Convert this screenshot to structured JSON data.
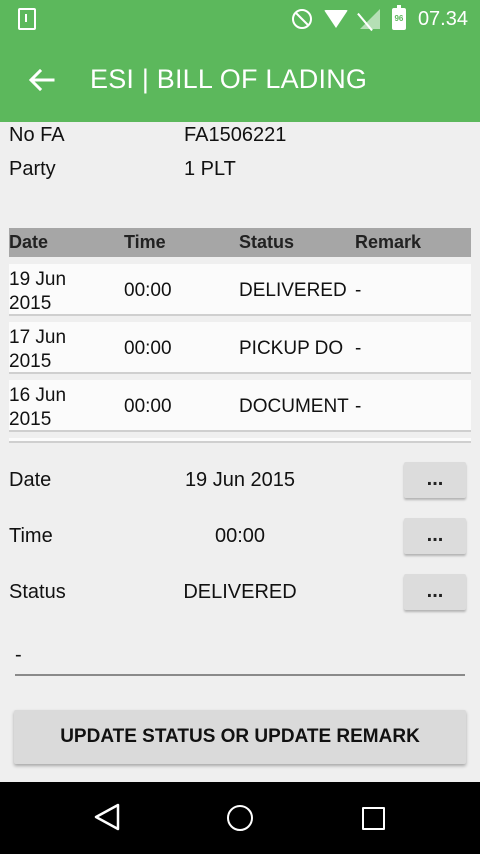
{
  "status_bar": {
    "time": "07.34",
    "battery_level": "96",
    "icons": [
      "download-icon",
      "dnd-icon",
      "wifi-icon",
      "no-signal-icon",
      "battery-icon"
    ]
  },
  "app_bar": {
    "title": "ESI | BILL OF LADING",
    "back_icon": "arrow-back-icon",
    "color": "#5cb85c"
  },
  "info": {
    "no_fa_label": "No FA",
    "no_fa_value": "FA1506221",
    "party_label": "Party",
    "party_value": "1 PLT"
  },
  "table": {
    "headers": [
      "Date",
      "Time",
      "Status",
      "Remark"
    ],
    "rows": [
      {
        "date": "19 Jun 2015",
        "time": "00:00",
        "status": "DELIVERED",
        "remark": "-"
      },
      {
        "date": "17 Jun 2015",
        "time": "00:00",
        "status": "PICKUP DO",
        "remark": "-"
      },
      {
        "date": "16 Jun 2015",
        "time": "00:00",
        "status": "DOCUMENT",
        "remark": "-"
      }
    ]
  },
  "form": {
    "date_label": "Date",
    "date_value": "19 Jun 2015",
    "time_label": "Time",
    "time_value": "00:00",
    "status_label": "Status",
    "status_value": "DELIVERED",
    "picker_label": "...",
    "remark_value": "-"
  },
  "update_button": "UPDATE STATUS OR UPDATE REMARK",
  "nav_bar": {
    "icons": [
      "nav-back-icon",
      "nav-home-icon",
      "nav-recents-icon"
    ]
  }
}
